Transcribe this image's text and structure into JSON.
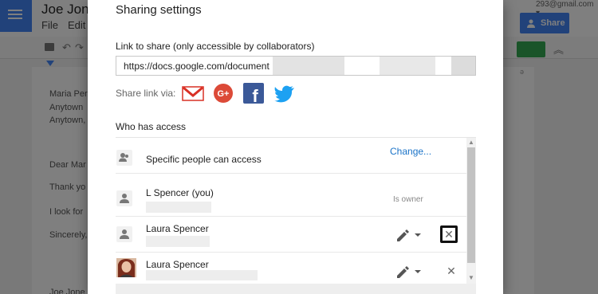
{
  "background": {
    "doc_title": "Joe Jon",
    "menu": {
      "file": "File",
      "edit": "Edit"
    },
    "account_email": "293@gmail.com ▾",
    "share_button_label": "Share",
    "doc_lines": [
      "Maria Per",
      "Anytown",
      "Anytown,",
      "Dear Mar",
      "Thank yo",
      "I look for",
      "Sincerely,",
      "Joe Jone"
    ],
    "right_margin_text": "ə"
  },
  "dialog": {
    "title": "Sharing settings",
    "link_label": "Link to share (only accessible by collaborators)",
    "link_value": "https://docs.google.com/document",
    "share_via_label": "Share link via:",
    "social_icons": [
      "gmail-icon",
      "google-plus-icon",
      "facebook-icon",
      "twitter-icon"
    ],
    "who_has_access_label": "Who has access",
    "access_setting": {
      "label": "Specific people can access",
      "change_link": "Change..."
    },
    "people": [
      {
        "name": "L Spencer (you)",
        "role": "Is owner"
      },
      {
        "name": "Laura Spencer",
        "permission_icon": "pencil-icon",
        "remove_icon": "close-icon"
      },
      {
        "name": "Laura Spencer",
        "permission_icon": "pencil-icon",
        "remove_icon": "close-icon",
        "avatar": "photo"
      }
    ],
    "remove_symbol": "✕",
    "scroll_up": "▲",
    "scroll_down": "▼"
  },
  "colors": {
    "accent_blue": "#1a73c8",
    "share_blue": "#4285f4",
    "gmail_red": "#d93025",
    "gplus_red": "#dc4a38",
    "facebook_blue": "#3b5998",
    "twitter_blue": "#1da1f2"
  }
}
